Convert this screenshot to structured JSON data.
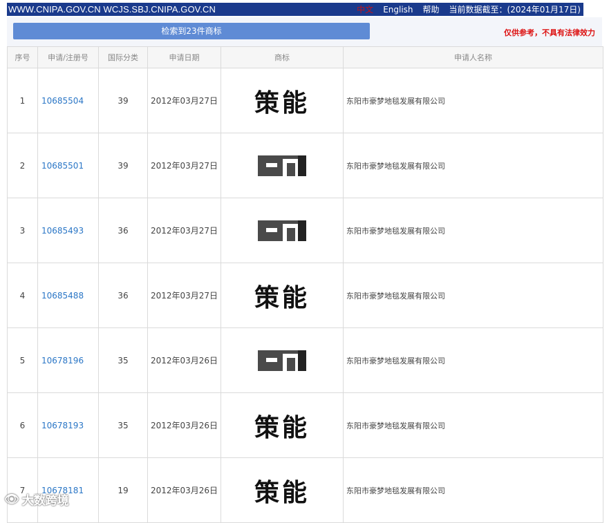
{
  "topbar": {
    "urls": "WWW.CNIPA.GOV.CN WCJS.SBJ.CNIPA.GOV.CN",
    "lang_zh": "中文",
    "lang_en": "English",
    "help": "帮助",
    "data_cutoff": "当前数据截至：(2024年01月17日)"
  },
  "summary": {
    "result_label": "检索到23件商标",
    "disclaimer": "仅供参考，不具有法律效力"
  },
  "table": {
    "headers": [
      "序号",
      "申请/注册号",
      "国际分类",
      "申请日期",
      "商标",
      "申请人名称"
    ],
    "rows": [
      {
        "no": "1",
        "reg": "10685504",
        "class": "39",
        "date": "2012年03月27日",
        "mark": "策能",
        "mark_type": "text",
        "owner": "东阳市豪梦地毯发展有限公司"
      },
      {
        "no": "2",
        "reg": "10685501",
        "class": "39",
        "date": "2012年03月27日",
        "mark": "",
        "mark_type": "logo",
        "owner": "东阳市豪梦地毯发展有限公司"
      },
      {
        "no": "3",
        "reg": "10685493",
        "class": "36",
        "date": "2012年03月27日",
        "mark": "",
        "mark_type": "logo",
        "owner": "东阳市豪梦地毯发展有限公司"
      },
      {
        "no": "4",
        "reg": "10685488",
        "class": "36",
        "date": "2012年03月27日",
        "mark": "策能",
        "mark_type": "text",
        "owner": "东阳市豪梦地毯发展有限公司"
      },
      {
        "no": "5",
        "reg": "10678196",
        "class": "35",
        "date": "2012年03月26日",
        "mark": "",
        "mark_type": "logo",
        "owner": "东阳市豪梦地毯发展有限公司"
      },
      {
        "no": "6",
        "reg": "10678193",
        "class": "35",
        "date": "2012年03月26日",
        "mark": "策能",
        "mark_type": "text",
        "owner": "东阳市豪梦地毯发展有限公司"
      },
      {
        "no": "7",
        "reg": "10678181",
        "class": "19",
        "date": "2012年03月26日",
        "mark": "策能",
        "mark_type": "text",
        "owner": "东阳市豪梦地毯发展有限公司"
      }
    ]
  },
  "watermark": {
    "text": "大数跨境"
  },
  "colors": {
    "topbar": "#1a3a8c",
    "button": "#5f8bd5",
    "link": "#2a76c6",
    "disclaimer": "#d11111"
  }
}
